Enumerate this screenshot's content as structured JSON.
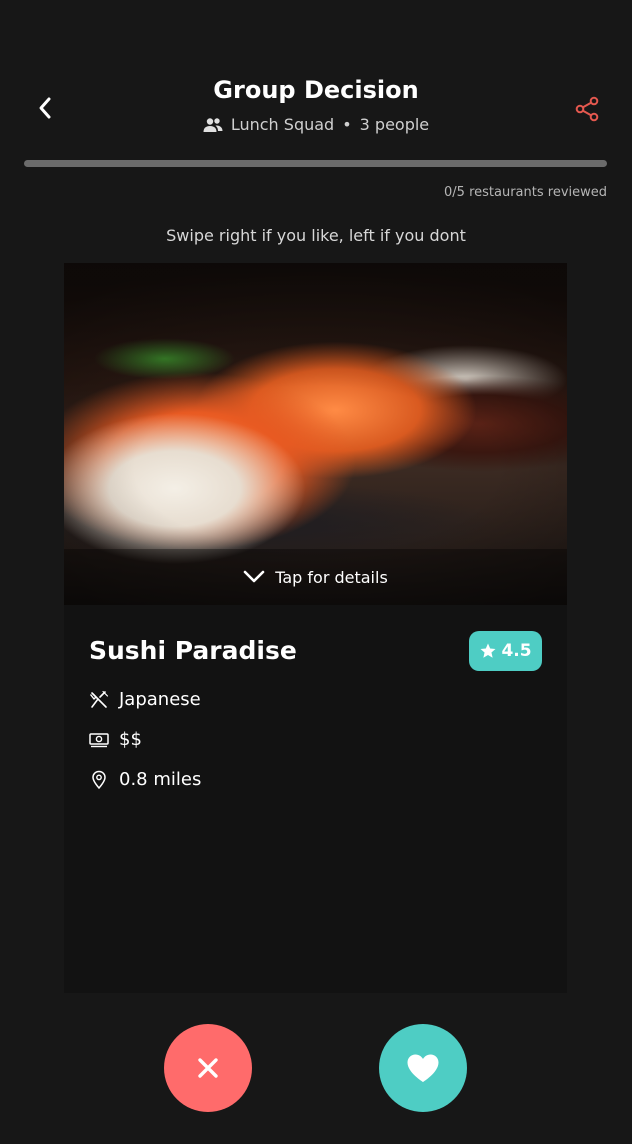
{
  "header": {
    "title": "Group Decision",
    "group_name": "Lunch Squad",
    "separator": "•",
    "people_count": "3 people",
    "back_icon": "chevron-left-icon",
    "share_icon": "share-icon"
  },
  "progress": {
    "reviewed": 0,
    "total": 5,
    "fraction": 0,
    "label": "0/5 restaurants reviewed"
  },
  "instruction": "Swipe right if you like, left if you dont",
  "card": {
    "tap_label": "Tap for details",
    "name": "Sushi Paradise",
    "rating": "4.5",
    "cuisine": "Japanese",
    "price": "$$",
    "distance": "0.8 miles",
    "icons": {
      "cuisine": "utensils-icon",
      "price": "money-icon",
      "distance": "location-pin-icon"
    }
  },
  "actions": {
    "dislike_icon": "close-icon",
    "like_icon": "heart-icon"
  },
  "colors": {
    "background": "#171717",
    "accent_teal": "#4ecdc4",
    "accent_red": "#ff6b6b",
    "share": "#e4584f"
  }
}
